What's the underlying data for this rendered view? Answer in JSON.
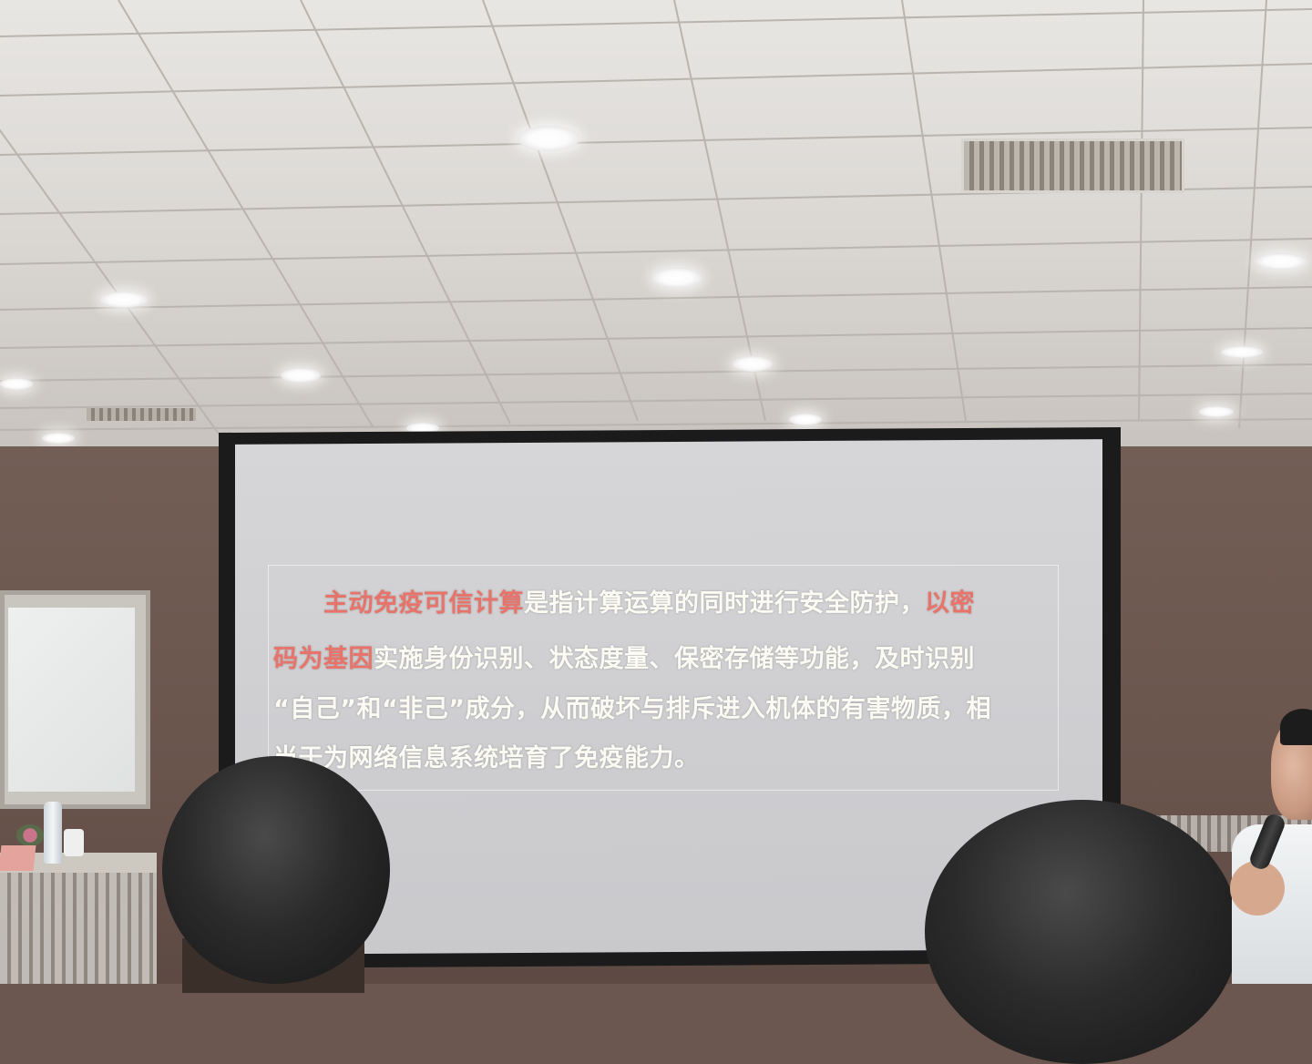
{
  "slide": {
    "lines": [
      [
        {
          "text": "主动免疫可信计算",
          "highlight": true
        },
        {
          "text": "是指计算运算的同时进行安全防护，",
          "highlight": false
        },
        {
          "text": "以密",
          "highlight": true
        }
      ],
      [
        {
          "text": "码为基因",
          "highlight": true
        },
        {
          "text": "实施身份识别、状态度量、保密存储等功能，及时识别",
          "highlight": false
        }
      ],
      [
        {
          "text": " “自己”和“非己”成分，从而破坏与排斥进入机体的有害物质，相",
          "highlight": false
        }
      ],
      [
        {
          "text": "当于为网络信息系统培育了免疫能力。",
          "highlight": false
        }
      ]
    ],
    "colors": {
      "normal_text": "#fbfbf4",
      "highlight_text": "#e8736a",
      "screen": "#d2d2d5"
    }
  },
  "scene": {
    "ceiling_lights": 10,
    "icons": [
      "ceiling-light",
      "air-vent",
      "whiteboard",
      "projector-screen",
      "microphone"
    ]
  }
}
